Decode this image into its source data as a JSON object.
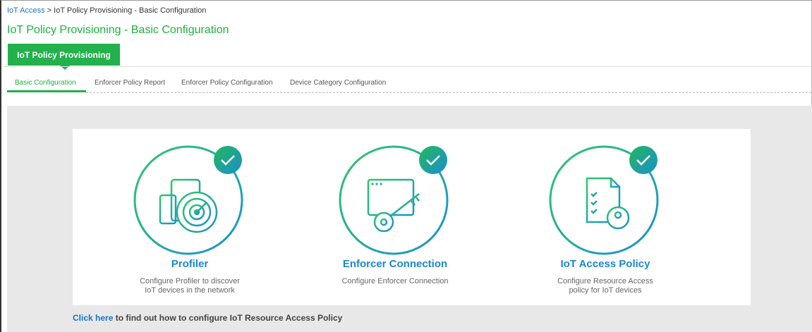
{
  "breadcrumb": {
    "link": "IoT Access",
    "separator": " > ",
    "current": "IoT Policy Provisioning - Basic Configuration"
  },
  "page_title": "IoT Policy Provisioning - Basic Configuration",
  "main_tab": {
    "label": "IoT Policy Provisioning",
    "color": "#23b14d"
  },
  "subtabs": [
    {
      "label": "Basic Configuration",
      "active": true
    },
    {
      "label": "Enforcer Policy Report",
      "active": false
    },
    {
      "label": "Enforcer Policy Configuration",
      "active": false
    },
    {
      "label": "Device Category Configuration",
      "active": false
    }
  ],
  "features": [
    {
      "title": "Profiler",
      "description": "Configure Profiler to discover IoT devices in the network",
      "status": "configured",
      "icon": "devices-radar-icon"
    },
    {
      "title": "Enforcer Connection",
      "description": "Configure Enforcer Connection",
      "status": "configured",
      "icon": "browser-key-icon"
    },
    {
      "title": "IoT Access Policy",
      "description": "Configure Resource Access policy for IoT devices",
      "status": "configured",
      "icon": "document-lock-icon"
    }
  ],
  "help": {
    "link": "Click here",
    "text": " to find out how to configure IoT Resource Access Policy"
  },
  "colors": {
    "accent_green": "#23b14d",
    "link_blue": "#1a73c8",
    "title_blue": "#1a87d4"
  }
}
